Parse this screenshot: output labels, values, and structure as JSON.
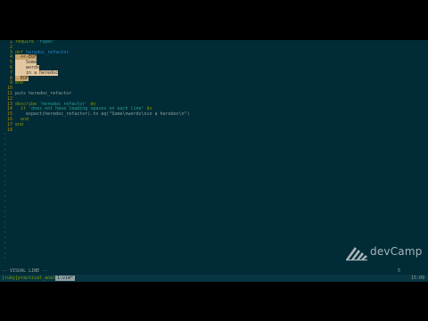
{
  "editor": {
    "lines": [
      {
        "n": "1",
        "text": "require \"rspec\""
      },
      {
        "n": "2",
        "text": ""
      },
      {
        "n": "3",
        "text": "def heredoc_refactor"
      },
      {
        "n": "4",
        "text": "  <<-EOF"
      },
      {
        "n": "5",
        "text": "    Some"
      },
      {
        "n": "6",
        "text": "    words"
      },
      {
        "n": "7",
        "text": "    in a heredoc"
      },
      {
        "n": "8",
        "text": "  EOF"
      },
      {
        "n": "9",
        "text": "end"
      },
      {
        "n": "10",
        "text": ""
      },
      {
        "n": "11",
        "text": "puts heredoc_refactor"
      },
      {
        "n": "12",
        "text": ""
      },
      {
        "n": "13",
        "text": "describe 'heredoc refactor' do"
      },
      {
        "n": "14",
        "text": "  it 'does not have leading spaces on each line' do"
      },
      {
        "n": "15",
        "text": "    expect(heredoc_refactor).to eq(\"Some\\nwords\\nin a heredoc\\n\")"
      },
      {
        "n": "16",
        "text": "  end"
      },
      {
        "n": "17",
        "text": "end"
      },
      {
        "n": "18",
        "text": ""
      }
    ],
    "tilde": "~"
  },
  "status": {
    "mode": "-- VISUAL LINE --",
    "selection_count": "5"
  },
  "tmux": {
    "session": "[ruby]practical_anal",
    "window": "1:vim*",
    "clock": "15:09"
  },
  "watermark": {
    "brand": "devCamp"
  },
  "colors": {
    "background": "#012b36",
    "line_number": "#b58900",
    "keyword": "#859900",
    "string": "#2aa198",
    "selection": "#c7a46e"
  }
}
